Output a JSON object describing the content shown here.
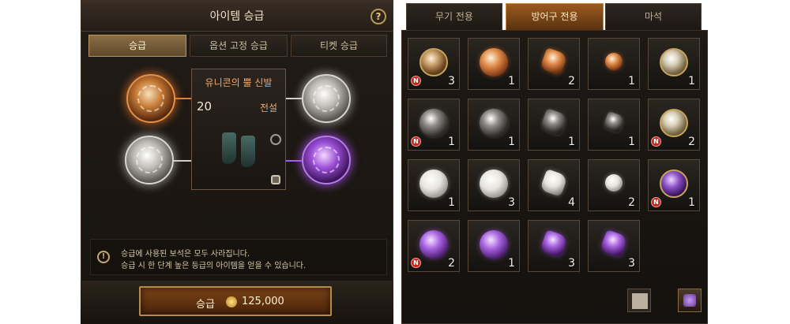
{
  "left_panel": {
    "title": "아이템 승급",
    "help_label": "?",
    "tabs": [
      {
        "label": "승급",
        "active": true
      },
      {
        "label": "옵션 고정 승급",
        "active": false
      },
      {
        "label": "티켓 승급",
        "active": false
      }
    ],
    "item": {
      "name": "유니콘의 뿔 신발",
      "level": "20",
      "grade": "전설"
    },
    "notice": {
      "line1": "승급에 사용된 보석은 모두 사라집니다.",
      "line2": "승급 시 한 단계 높은 등급의 아이템을 얻을 수 있습니다."
    },
    "upgrade_button": {
      "label": "승급",
      "cost": "125,000"
    }
  },
  "right_panel": {
    "tabs": [
      {
        "label": "무기 전용",
        "active": false
      },
      {
        "label": "방어구 전용",
        "active": true
      },
      {
        "label": "마석",
        "active": false
      }
    ],
    "new_badge": "N",
    "inventory": [
      {
        "icon": "gold-orange-orb-icon",
        "count": "3",
        "new": true
      },
      {
        "icon": "orange-orb-icon",
        "count": "1",
        "new": false
      },
      {
        "icon": "orange-shard-icon",
        "count": "2",
        "new": false
      },
      {
        "icon": "orange-small-gem-icon",
        "count": "1",
        "new": false
      },
      {
        "icon": "gold-silver-orb-icon",
        "count": "1",
        "new": false
      },
      {
        "icon": "dark-orb-icon",
        "count": "1",
        "new": true
      },
      {
        "icon": "dark-orb-icon",
        "count": "1",
        "new": false
      },
      {
        "icon": "dark-shard-icon",
        "count": "1",
        "new": false
      },
      {
        "icon": "dark-small-gem-icon",
        "count": "1",
        "new": false
      },
      {
        "icon": "gold-silver-orb-icon",
        "count": "2",
        "new": true
      },
      {
        "icon": "white-orb-icon",
        "count": "1",
        "new": false
      },
      {
        "icon": "white-orb-icon",
        "count": "3",
        "new": false
      },
      {
        "icon": "white-shard-icon",
        "count": "4",
        "new": false
      },
      {
        "icon": "white-small-gem-icon",
        "count": "2",
        "new": false
      },
      {
        "icon": "gold-purple-orb-icon",
        "count": "1",
        "new": true
      },
      {
        "icon": "purple-orb-icon",
        "count": "2",
        "new": true
      },
      {
        "icon": "purple-orb-icon",
        "count": "1",
        "new": false
      },
      {
        "icon": "purple-shard-icon",
        "count": "3",
        "new": false
      },
      {
        "icon": "purple-small-gem-icon",
        "count": "3",
        "new": false
      }
    ]
  }
}
